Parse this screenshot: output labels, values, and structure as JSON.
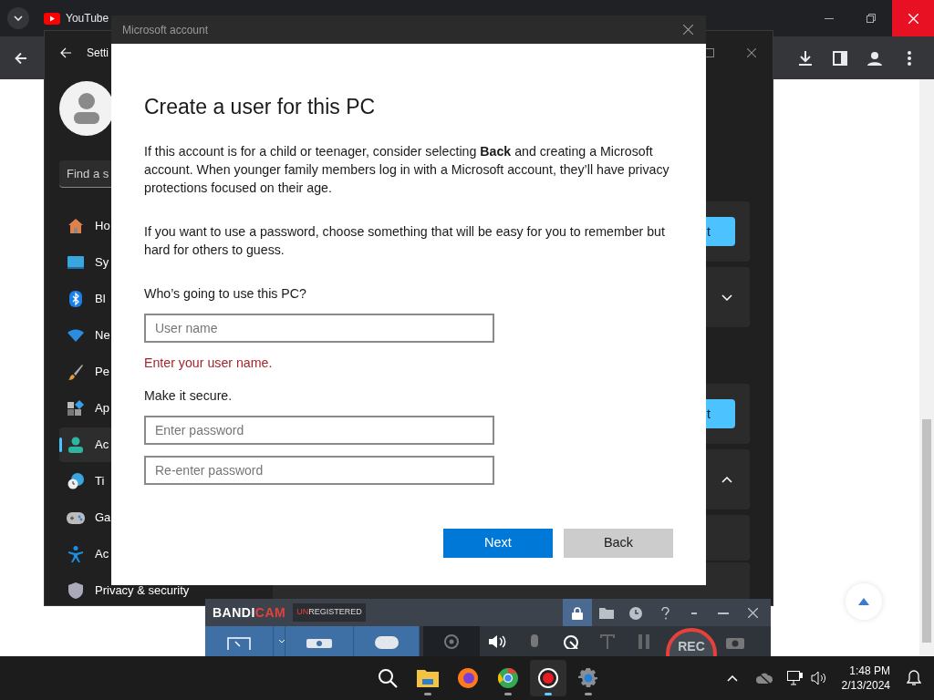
{
  "browser": {
    "tabs": [
      {
        "label": "YouTube"
      }
    ]
  },
  "settings": {
    "title": "Setti",
    "search": {
      "placeholder": "Find a s"
    },
    "nav": [
      {
        "label": "Ho",
        "selected": false
      },
      {
        "label": "Sy",
        "selected": false
      },
      {
        "label": "Bl",
        "selected": false
      },
      {
        "label": "Ne",
        "selected": false
      },
      {
        "label": "Pe",
        "selected": false
      },
      {
        "label": "Ap",
        "selected": false
      },
      {
        "label": "Ac",
        "selected": true
      },
      {
        "label": "Ti",
        "selected": false
      },
      {
        "label": "Ga",
        "selected": false
      },
      {
        "label": "Ac",
        "selected": false
      },
      {
        "label": "Privacy & security",
        "selected": false
      }
    ],
    "cards": [
      {
        "kind": "button",
        "label": "t"
      },
      {
        "kind": "chevron",
        "expanded": false
      },
      {
        "kind": "gap"
      },
      {
        "kind": "button",
        "label": "t"
      },
      {
        "kind": "chevron",
        "expanded": true
      },
      {
        "kind": "blank"
      },
      {
        "kind": "blank"
      }
    ]
  },
  "dialog": {
    "title": "Microsoft account",
    "heading": "Create a user for this PC",
    "paragraphs": [
      "If this account is for a child or teenager, consider selecting **Back** and creating a Microsoft account. When younger family members log in with a Microsoft account, they’ll have privacy protections focused on their age.",
      "If you want to use a password, choose something that will be easy for you to remember but hard for others to guess."
    ],
    "question": "Who’s going to use this PC?",
    "username": {
      "placeholder": "User name"
    },
    "error": "Enter your user name.",
    "secure_label": "Make it secure.",
    "password": {
      "placeholder": "Enter password"
    },
    "password_repeat": {
      "placeholder": "Re-enter password"
    },
    "buttons": [
      {
        "label": "Next",
        "kind": "primary"
      },
      {
        "label": "Back",
        "kind": "secondary"
      }
    ]
  },
  "bandicam": {
    "logo_main": "BANDI",
    "logo_accent": "CAM",
    "badge_accent": "UN",
    "badge_main": "REGISTERED",
    "rec": "REC"
  },
  "taskbar": {
    "apps": [
      {
        "selected": false,
        "running": false
      },
      {
        "selected": false,
        "running": true
      },
      {
        "selected": false,
        "running": false
      },
      {
        "selected": false,
        "running": true
      },
      {
        "selected": true,
        "running": true
      },
      {
        "selected": false,
        "running": true
      }
    ],
    "time": "1:48 PM",
    "date": "2/13/2024"
  }
}
